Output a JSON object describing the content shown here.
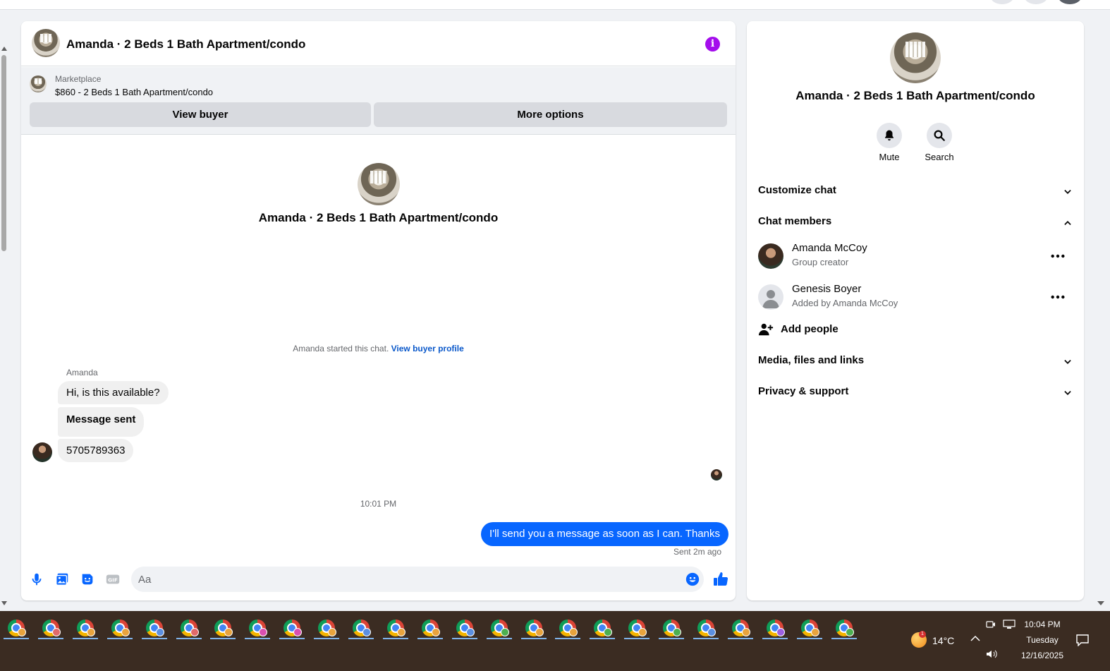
{
  "chat": {
    "title": "Amanda · 2 Beds 1 Bath Apartment/condo",
    "marketplace_label": "Marketplace",
    "listing": "$860 - 2 Beds 1 Bath Apartment/condo",
    "view_buyer_label": "View buyer",
    "more_options_label": "More options",
    "center_title": "Amanda · 2 Beds 1 Bath Apartment/condo",
    "started_text": "Amanda started this chat.",
    "view_buyer_profile_link": "View buyer profile",
    "sender_name": "Amanda",
    "messages_in": [
      "Hi, is this available?",
      "Message sent",
      "5705789363"
    ],
    "timestamp": "10:01 PM",
    "message_out": "I'll send you a message as soon as I can. Thanks",
    "sent_status": "Sent 2m ago",
    "composer_placeholder": "Aa"
  },
  "side": {
    "title": "Amanda · 2 Beds 1 Bath Apartment/condo",
    "mute_label": "Mute",
    "search_label": "Search",
    "customize_chat": "Customize chat",
    "chat_members": "Chat members",
    "members": [
      {
        "name": "Amanda McCoy",
        "sub": "Group creator"
      },
      {
        "name": "Genesis Boyer",
        "sub": "Added by Amanda McCoy"
      }
    ],
    "add_people": "Add people",
    "media_files_links": "Media, files and links",
    "privacy_support": "Privacy & support"
  },
  "taskbar": {
    "temperature": "14°C",
    "weather_badge": "1",
    "time": "10:04 PM",
    "day": "Tuesday",
    "date": "12/16/2025",
    "app_badge_colors": [
      "#e8a33d",
      "#e06a6a",
      "#e8a33d",
      "#e8a33d",
      "#5b8fe0",
      "#e06a6a",
      "#e8a33d",
      "#d94fb0",
      "#d94fb0",
      "#e8a33d",
      "#5b8fe0",
      "#e8a33d",
      "#e8a33d",
      "#5b8fe0",
      "#4caf50",
      "#e8a33d",
      "#e8a33d",
      "#4caf50",
      "#e8a33d",
      "#4caf50",
      "#5b8fe0",
      "#e8a33d",
      "#9c5fe0",
      "#e8a33d",
      "#4caf50"
    ]
  },
  "colors": {
    "accent_blue": "#0866ff",
    "info_purple": "#a40dec",
    "link_blue": "#0a58ca"
  }
}
